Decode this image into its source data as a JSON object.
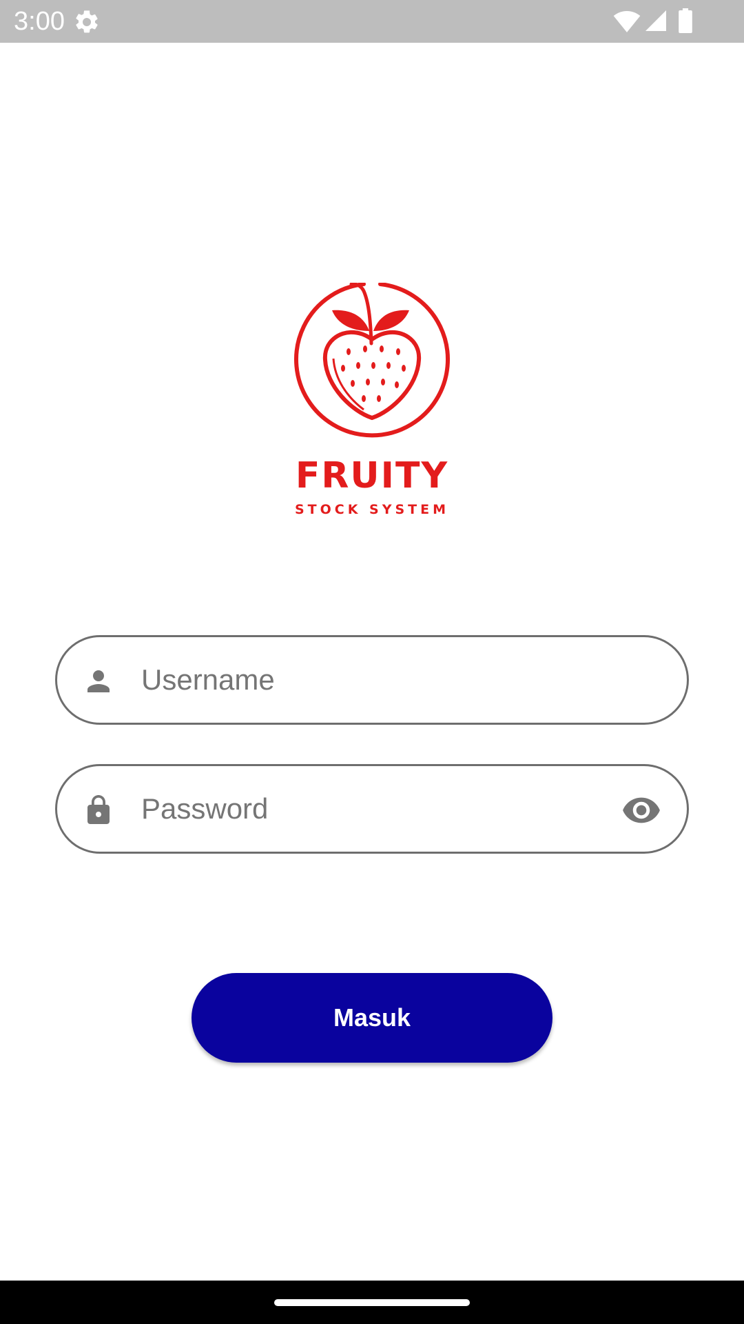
{
  "status_bar": {
    "time": "3:00",
    "icons": [
      "gear-icon",
      "wifi-icon",
      "signal-icon",
      "battery-icon"
    ]
  },
  "logo": {
    "icon": "strawberry-logo-icon",
    "title": "FRUITY",
    "subtitle": "STOCK SYSTEM",
    "color": "#e31c1c"
  },
  "form": {
    "username": {
      "placeholder": "Username",
      "value": "",
      "icon": "person-icon"
    },
    "password": {
      "placeholder": "Password",
      "value": "",
      "icon": "lock-icon",
      "toggle_icon": "eye-icon"
    },
    "submit_label": "Masuk"
  },
  "colors": {
    "button": "#0a039e",
    "field_border": "#6e6e6e",
    "icon_gray": "#757575"
  }
}
